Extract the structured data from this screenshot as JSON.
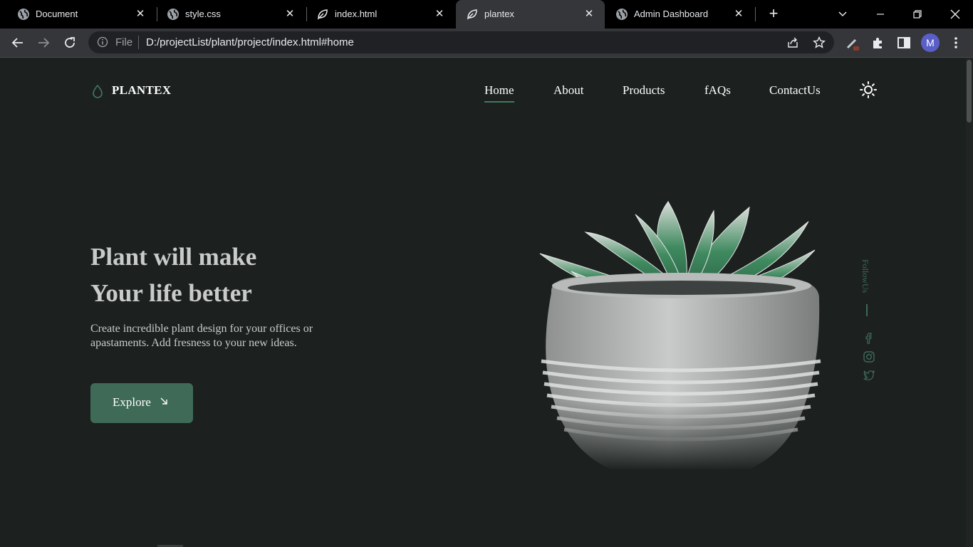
{
  "browser": {
    "tabs": [
      {
        "title": "Document",
        "icon": "globe-icon",
        "close": "✕"
      },
      {
        "title": "style.css",
        "icon": "globe-icon",
        "close": "✕"
      },
      {
        "title": "index.html",
        "icon": "leaf-icon",
        "close": "✕"
      },
      {
        "title": "plantex",
        "icon": "leaf-icon",
        "close": "✕",
        "active": true
      },
      {
        "title": "Admin Dashboard",
        "icon": "globe-icon",
        "close": "✕"
      }
    ],
    "newtab": "+",
    "address": {
      "scheme_label": "File",
      "url": "D:/projectList/plant/project/index.html#home"
    },
    "profile_initial": "M",
    "colors": {
      "tabstrip": "#000000",
      "toolbar": "#35363a",
      "omnibox": "#202124",
      "avatar": "#5a5fc8"
    }
  },
  "site": {
    "logo_text": "PLANTEX",
    "nav": {
      "home": "Home",
      "about": "About",
      "products": "Products",
      "faqs": "fAQs",
      "contact": "ContactUs"
    },
    "active_nav": "Home",
    "hero": {
      "title_line1": "Plant will make",
      "title_line2": "Your life better",
      "description": "Create incredible plant design for your offices or apastaments. Add fresness to your new ideas.",
      "button_label": "Explore"
    },
    "follow_label": "FollowUs",
    "social_icons": [
      "facebook-icon",
      "instagram-icon",
      "twitter-icon"
    ],
    "colors": {
      "background": "#1c2120",
      "accent": "#3f6a57",
      "text": "#c8cbc9",
      "heading": "#ffffff"
    }
  }
}
